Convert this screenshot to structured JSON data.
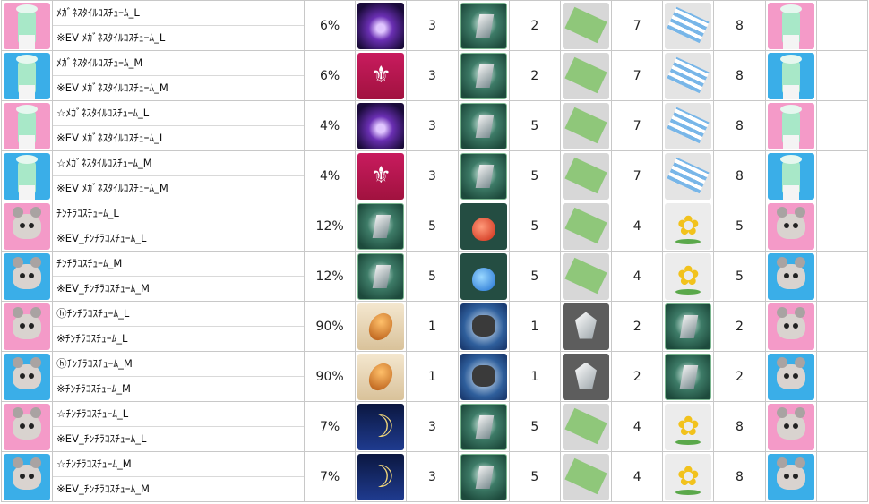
{
  "rows": [
    {
      "name": "ﾒｶﾞﾈｽﾀｲﾙｺｽﾁｭｰﾑ_L",
      "ev": "※EV ﾒｶﾞﾈｽﾀｲﾙｺｽﾁｭｰﾑ_L",
      "avatar": "pink-costume-icon",
      "rate": "6%",
      "m1": "magic-orb-icon",
      "q1": "3",
      "m2": "crystal-shard-icon",
      "q2": "2",
      "m3": "green-fabric-icon",
      "q3": "7",
      "m4": "striped-fabric-icon",
      "q4": "8",
      "avatar2": "pink-costume-icon"
    },
    {
      "name": "ﾒｶﾞﾈｽﾀｲﾙｺｽﾁｭｰﾑ_M",
      "ev": "※EV ﾒｶﾞﾈｽﾀｲﾙｺｽﾁｭｰﾑ_M",
      "avatar": "blue-costume-icon",
      "rate": "6%",
      "m1": "fleur-crest-icon",
      "q1": "3",
      "m2": "crystal-shard-icon",
      "q2": "2",
      "m3": "green-fabric-icon",
      "q3": "7",
      "m4": "striped-fabric-icon",
      "q4": "8",
      "avatar2": "blue-costume-icon"
    },
    {
      "name": "☆ﾒｶﾞﾈｽﾀｲﾙｺｽﾁｭｰﾑ_L",
      "ev": "※EV ﾒｶﾞﾈｽﾀｲﾙｺｽﾁｭｰﾑ_L",
      "avatar": "pink-costume-icon",
      "rate": "4%",
      "m1": "magic-orb-icon",
      "q1": "3",
      "m2": "crystal-shard-icon",
      "q2": "5",
      "m3": "green-fabric-icon",
      "q3": "7",
      "m4": "striped-fabric-icon",
      "q4": "8",
      "avatar2": "pink-costume-icon"
    },
    {
      "name": "☆ﾒｶﾞﾈｽﾀｲﾙｺｽﾁｭｰﾑ_M",
      "ev": "※EV ﾒｶﾞﾈｽﾀｲﾙｺｽﾁｭｰﾑ_M",
      "avatar": "blue-costume-icon",
      "rate": "4%",
      "m1": "fleur-crest-icon",
      "q1": "3",
      "m2": "crystal-shard-icon",
      "q2": "5",
      "m3": "green-fabric-icon",
      "q3": "7",
      "m4": "striped-fabric-icon",
      "q4": "8",
      "avatar2": "blue-costume-icon"
    },
    {
      "name": "ﾁﾝﾁﾗｺｽﾁｭｰﾑ_L",
      "ev": "※EV_ﾁﾝﾁﾗｺｽﾁｭｰﾑ_L",
      "avatar": "pink-chinchilla-icon",
      "rate": "12%",
      "m1": "crystal-shard-icon",
      "q1": "5",
      "m2": "red-potion-icon",
      "q2": "5",
      "m3": "green-fabric-icon",
      "q3": "4",
      "m4": "yellow-flower-icon",
      "q4": "5",
      "avatar2": "pink-chinchilla-icon"
    },
    {
      "name": "ﾁﾝﾁﾗｺｽﾁｭｰﾑ_M",
      "ev": "※EV_ﾁﾝﾁﾗｺｽﾁｭｰﾑ_M",
      "avatar": "blue-chinchilla-icon",
      "rate": "12%",
      "m1": "crystal-shard-icon",
      "q1": "5",
      "m2": "blue-potion-icon",
      "q2": "5",
      "m3": "green-fabric-icon",
      "q3": "4",
      "m4": "yellow-flower-icon",
      "q4": "5",
      "avatar2": "blue-chinchilla-icon"
    },
    {
      "name": "ⓗﾁﾝﾁﾗｺｽﾁｭｰﾑ_L",
      "ev": "※ﾁﾝﾁﾗｺｽﾁｭｰﾑ_L",
      "avatar": "pink-chinchilla-icon",
      "rate": "90%",
      "m1": "amber-bean-icon",
      "q1": "1",
      "m2": "dark-rock-icon",
      "q2": "1",
      "m3": "white-crystal-icon",
      "q3": "2",
      "m4": "crystal-shard-icon",
      "q4": "2",
      "avatar2": "pink-chinchilla-icon"
    },
    {
      "name": "ⓗﾁﾝﾁﾗｺｽﾁｭｰﾑ_M",
      "ev": "※ﾁﾝﾁﾗｺｽﾁｭｰﾑ_M",
      "avatar": "blue-chinchilla-icon",
      "rate": "90%",
      "m1": "amber-bean-icon",
      "q1": "1",
      "m2": "dark-rock-icon",
      "q2": "1",
      "m3": "white-crystal-icon",
      "q3": "2",
      "m4": "crystal-shard-icon",
      "q4": "2",
      "avatar2": "blue-chinchilla-icon"
    },
    {
      "name": "☆ﾁﾝﾁﾗｺｽﾁｭｰﾑ_L",
      "ev": "※EV_ﾁﾝﾁﾗｺｽﾁｭｰﾑ_L",
      "avatar": "pink-chinchilla-icon",
      "rate": "7%",
      "m1": "crescent-moon-icon",
      "q1": "3",
      "m2": "crystal-shard-icon",
      "q2": "5",
      "m3": "green-fabric-icon",
      "q3": "4",
      "m4": "yellow-flower-icon",
      "q4": "8",
      "avatar2": "pink-chinchilla-icon"
    },
    {
      "name": "☆ﾁﾝﾁﾗｺｽﾁｭｰﾑ_M",
      "ev": "※EV_ﾁﾝﾁﾗｺｽﾁｭｰﾑ_M",
      "avatar": "blue-chinchilla-icon",
      "rate": "7%",
      "m1": "crescent-moon-icon",
      "q1": "3",
      "m2": "crystal-shard-icon",
      "q2": "5",
      "m3": "green-fabric-icon",
      "q3": "4",
      "m4": "yellow-flower-icon",
      "q4": "8",
      "avatar2": "blue-chinchilla-icon"
    }
  ]
}
